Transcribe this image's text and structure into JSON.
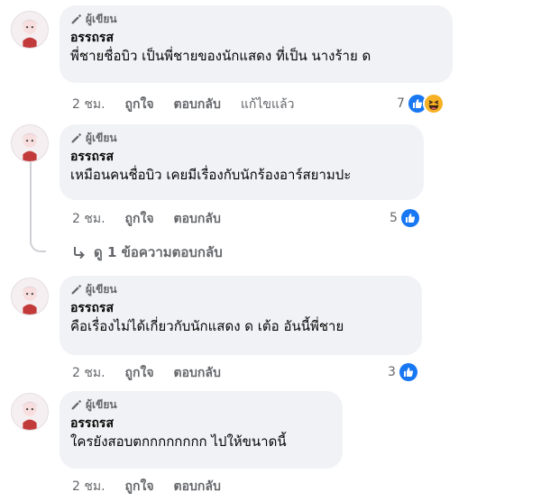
{
  "comments": [
    {
      "badge": "ผู้เขียน",
      "author": "อรรถรส",
      "text": "พี่ชายชื่อบิว เป็นพี่ชายของนักแสดง ที่เป็น นางร้าย ด",
      "time": "2 ชม.",
      "like": "ถูกใจ",
      "reply": "ตอบกลับ",
      "edited": "แก้ไขแล้ว",
      "reaction_count": "7",
      "reactions": [
        "like-icon",
        "haha-icon"
      ]
    },
    {
      "badge": "ผู้เขียน",
      "author": "อรรถรส",
      "text": "เหมือนคนชื่อบิว เคยมีเรื่องกับนักร้องอาร์สยามปะ",
      "time": "2 ชม.",
      "like": "ถูกใจ",
      "reply": "ตอบกลับ",
      "reaction_count": "5",
      "reactions": [
        "like-icon"
      ]
    },
    {
      "badge": "ผู้เขียน",
      "author": "อรรถรส",
      "text": "คือเรื่องไม่ได้เกี่ยวกับนักแสดง ด เต้อ อันนี้พี่ชาย",
      "time": "2 ชม.",
      "like": "ถูกใจ",
      "reply": "ตอบกลับ",
      "reaction_count": "3",
      "reactions": [
        "like-icon"
      ]
    },
    {
      "badge": "ผู้เขียน",
      "author": "อรรถรส",
      "text": "ใครยังสอบตกกกกกกกก ไปให้ขนาดนี้",
      "time": "2 ชม.",
      "like": "ถูกใจ",
      "reply": "ตอบกลับ"
    }
  ],
  "view_replies": "ดู 1 ข้อความตอบกลับ",
  "colors": {
    "bubble": "#f0f2f5",
    "meta_text": "#65676b",
    "like_blue": "#1877f2",
    "haha_yellow": "#f7b125"
  }
}
